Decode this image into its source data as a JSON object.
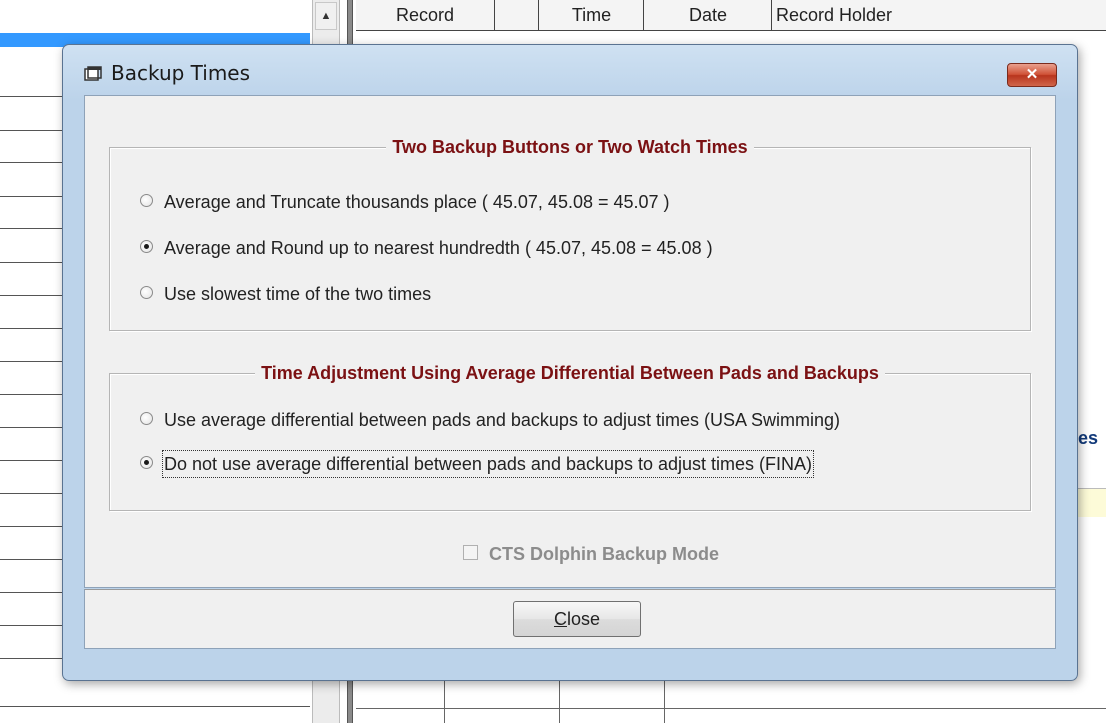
{
  "background": {
    "grid_headers": [
      "Record",
      "",
      "Time",
      "Date",
      "Record Holder"
    ],
    "right_label": "es"
  },
  "dialog": {
    "title": "Backup Times",
    "title_icon": "window-icon",
    "close_glyph": "✕",
    "group1": {
      "legend": "Two Backup Buttons or Two Watch Times",
      "options": [
        {
          "label": "Average and Truncate thousands place  ( 45.07, 45.08 = 45.07 )",
          "selected": false
        },
        {
          "label": "Average and Round up to nearest hundredth  ( 45.07, 45.08 = 45.08 )",
          "selected": true
        },
        {
          "label": "Use slowest time of the two times",
          "selected": false
        }
      ]
    },
    "group2": {
      "legend": "Time Adjustment Using Average Differential Between Pads and Backups",
      "options": [
        {
          "label": "Use average differential between pads and backups to adjust times (USA Swimming)",
          "selected": false
        },
        {
          "label": "Do not use average differential between pads and backups to adjust times (FINA)",
          "selected": true
        }
      ]
    },
    "checkbox": {
      "label": "CTS Dolphin Backup Mode",
      "checked": false,
      "enabled": false
    },
    "close_button": {
      "accel": "C",
      "rest": "lose"
    }
  }
}
